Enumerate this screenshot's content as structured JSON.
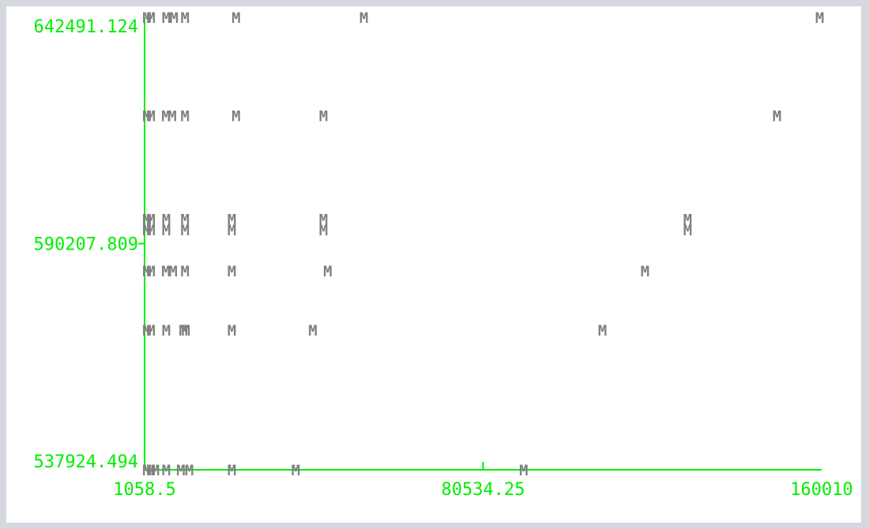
{
  "chart_data": {
    "type": "scatter",
    "title": "",
    "xlabel": "",
    "ylabel": "",
    "grid": false,
    "xlim": [
      1058.5,
      160010
    ],
    "ylim": [
      537924.494,
      642491.124
    ],
    "x_ticks": [
      {
        "value": 1058.5,
        "label": "1058.5"
      },
      {
        "value": 80534.25,
        "label": "80534.25"
      },
      {
        "value": 160010,
        "label": "160010"
      }
    ],
    "y_ticks": [
      {
        "value": 642491.124,
        "label": "642491.124"
      },
      {
        "value": 590207.809,
        "label": "590207.809"
      },
      {
        "value": 537924.494,
        "label": "537924.494"
      }
    ],
    "marker": "M",
    "marker_color": "#808080",
    "axis_color": "#00ee00",
    "points": [
      {
        "x": 1058.5,
        "y": 642491.124
      },
      {
        "x": 2000,
        "y": 642491.124
      },
      {
        "x": 5600,
        "y": 642491.124
      },
      {
        "x": 7400,
        "y": 642491.124
      },
      {
        "x": 10000,
        "y": 642491.124
      },
      {
        "x": 22000,
        "y": 642491.124
      },
      {
        "x": 52000,
        "y": 642491.124
      },
      {
        "x": 159000,
        "y": 642491.124
      },
      {
        "x": 1058.5,
        "y": 619800
      },
      {
        "x": 2000,
        "y": 619800
      },
      {
        "x": 5500,
        "y": 619800
      },
      {
        "x": 7000,
        "y": 619800
      },
      {
        "x": 10000,
        "y": 619800
      },
      {
        "x": 22000,
        "y": 619800
      },
      {
        "x": 42500,
        "y": 619800
      },
      {
        "x": 149000,
        "y": 619800
      },
      {
        "x": 1058.5,
        "y": 595900
      },
      {
        "x": 2000,
        "y": 595900
      },
      {
        "x": 5600,
        "y": 595900
      },
      {
        "x": 10000,
        "y": 595900
      },
      {
        "x": 21000,
        "y": 595900
      },
      {
        "x": 42500,
        "y": 595900
      },
      {
        "x": 128000,
        "y": 595900
      },
      {
        "x": 1058.5,
        "y": 593400
      },
      {
        "x": 2000,
        "y": 593400
      },
      {
        "x": 5600,
        "y": 593400
      },
      {
        "x": 10000,
        "y": 593400
      },
      {
        "x": 21000,
        "y": 593400
      },
      {
        "x": 42500,
        "y": 593400
      },
      {
        "x": 128000,
        "y": 593400
      },
      {
        "x": 1058.5,
        "y": 583900
      },
      {
        "x": 2000,
        "y": 583900
      },
      {
        "x": 5500,
        "y": 583900
      },
      {
        "x": 7200,
        "y": 583900
      },
      {
        "x": 10000,
        "y": 583900
      },
      {
        "x": 21000,
        "y": 583900
      },
      {
        "x": 43500,
        "y": 583900
      },
      {
        "x": 118000,
        "y": 583900
      },
      {
        "x": 1058.5,
        "y": 570200
      },
      {
        "x": 2000,
        "y": 570200
      },
      {
        "x": 5600,
        "y": 570200
      },
      {
        "x": 9600,
        "y": 570200
      },
      {
        "x": 10200,
        "y": 570200
      },
      {
        "x": 21000,
        "y": 570200
      },
      {
        "x": 40000,
        "y": 570200
      },
      {
        "x": 108000,
        "y": 570200
      },
      {
        "x": 1058.5,
        "y": 537924.494
      },
      {
        "x": 2000,
        "y": 537924.494
      },
      {
        "x": 3000,
        "y": 537924.494
      },
      {
        "x": 5600,
        "y": 537924.494
      },
      {
        "x": 9000,
        "y": 537924.494
      },
      {
        "x": 11000,
        "y": 537924.494
      },
      {
        "x": 21000,
        "y": 537924.494
      },
      {
        "x": 36000,
        "y": 537924.494
      },
      {
        "x": 89500,
        "y": 537924.494
      }
    ]
  }
}
